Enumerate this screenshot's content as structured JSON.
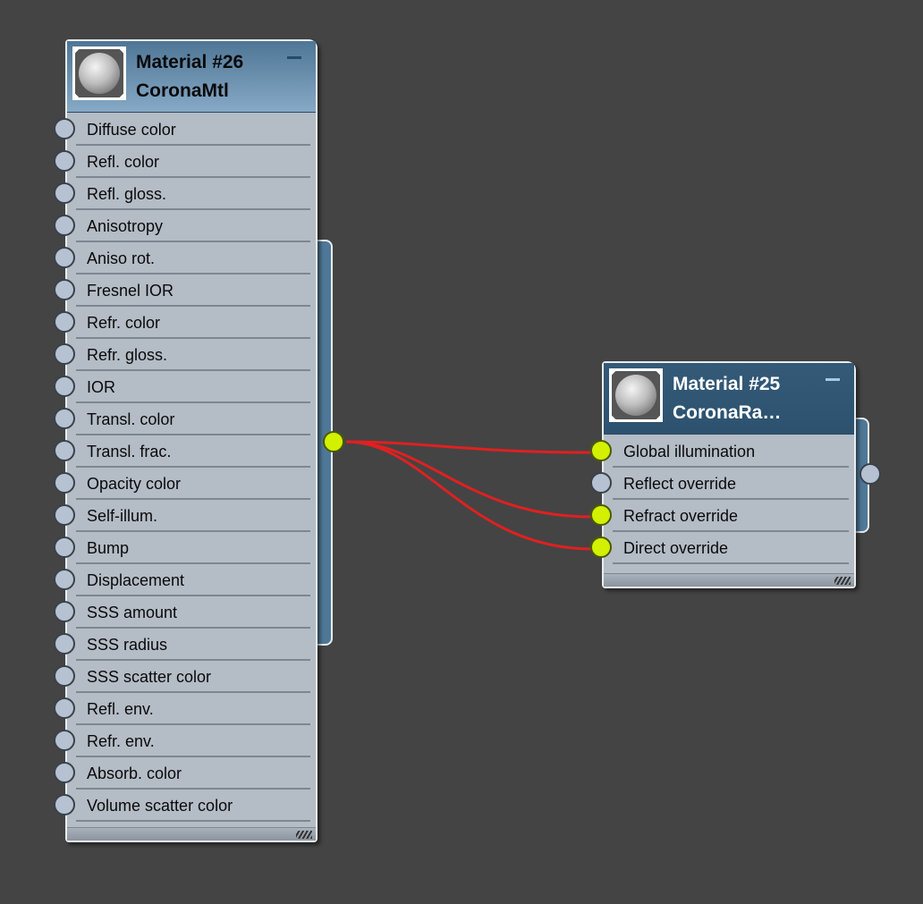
{
  "nodes": [
    {
      "id": "material-26",
      "name": "Material #26",
      "type": "CoronaMtl",
      "collapse_icon": "minimize-icon",
      "inputs": [
        "Diffuse color",
        "Refl. color",
        "Refl. gloss.",
        "Anisotropy",
        "Aniso rot.",
        "Fresnel IOR",
        "Refr. color",
        "Refr. gloss.",
        "IOR",
        "Transl. color",
        "Transl. frac.",
        "Opacity color",
        "Self-illum.",
        "Bump",
        "Displacement",
        "SSS amount",
        "SSS radius",
        "SSS scatter color",
        "Refl. env.",
        "Refr. env.",
        "Absorb. color",
        "Volume scatter color"
      ],
      "connected_inputs": [],
      "output_connected": true
    },
    {
      "id": "material-25",
      "name": "Material #25",
      "type": "CoronaRa…",
      "collapse_icon": "minimize-icon",
      "inputs": [
        "Global illumination",
        "Reflect override",
        "Refract override",
        "Direct override"
      ],
      "connected_inputs": [
        0,
        2,
        3
      ],
      "output_connected": false
    }
  ],
  "connections": [
    {
      "from": "Material #26",
      "to": "Material #25",
      "input": "Global illumination"
    },
    {
      "from": "Material #26",
      "to": "Material #25",
      "input": "Refract override"
    },
    {
      "from": "Material #26",
      "to": "Material #25",
      "input": "Direct override"
    }
  ],
  "colors": {
    "background": "#444444",
    "wire": "#e02020",
    "connected_socket": "#d2f000",
    "socket": "#b6c2d2"
  }
}
